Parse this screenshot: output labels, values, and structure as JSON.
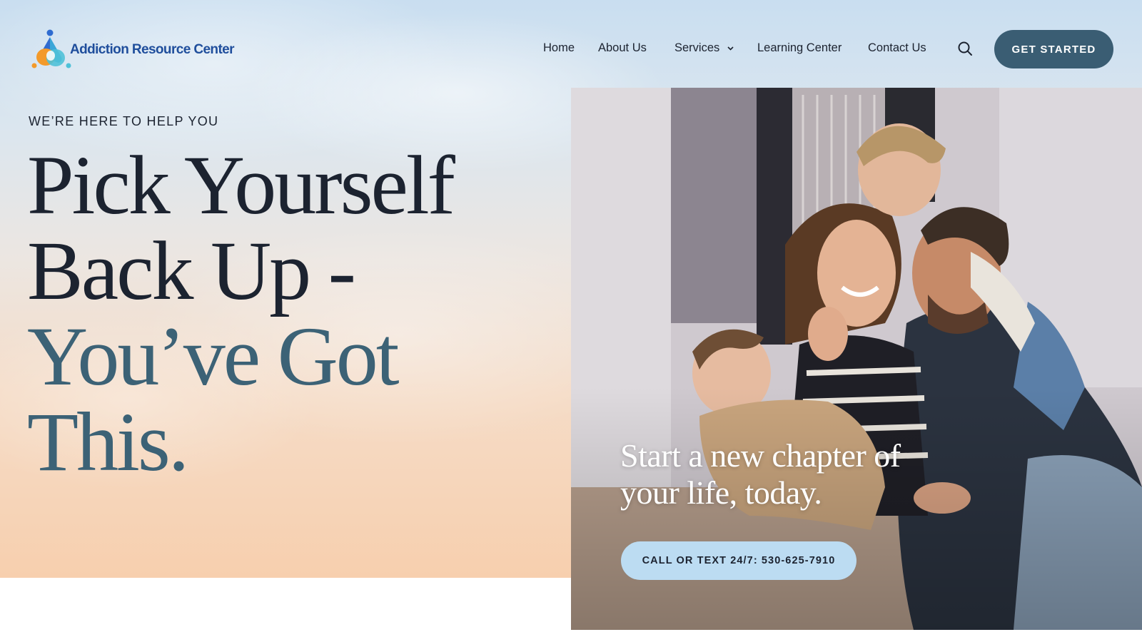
{
  "brand": {
    "name": "Addiction Resource Center"
  },
  "nav": {
    "items": [
      {
        "label": "Home"
      },
      {
        "label": "About Us"
      },
      {
        "label": "Services",
        "has_dropdown": true
      },
      {
        "label": "Learning Center"
      },
      {
        "label": "Contact Us"
      }
    ],
    "search_icon": "search-icon",
    "cta_label": "GET STARTED"
  },
  "hero": {
    "eyebrow": "WE’RE HERE TO HELP YOU",
    "headline_lines": [
      "Pick Yourself",
      "Back Up -",
      "You’ve Got",
      "This."
    ],
    "photo_caption": "Start a new chapter of your life, today.",
    "call_button_label": "CALL OR TEXT 24/7: 530-625-7910"
  },
  "colors": {
    "primary": "#3a5d73",
    "brand_text": "#1f4e9c",
    "headline_dark": "#1c2330",
    "headline_accent": "#3c6276",
    "call_button_bg": "#bcdcf2"
  }
}
